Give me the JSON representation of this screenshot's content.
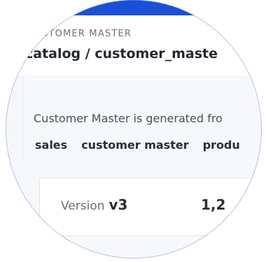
{
  "header": {
    "kicker": "STOMER MASTER",
    "path": "catalog / customer_maste"
  },
  "description": "Customer Master is generated fro",
  "tags": [
    {
      "label": "sales"
    },
    {
      "label": "customer master"
    },
    {
      "label": "produ"
    }
  ],
  "card": {
    "version_label": "Version",
    "version_value": "v3",
    "count": "1,2"
  },
  "colors": {
    "accent_bar": "#1b4fd8",
    "lens_border": "#6b86c9"
  }
}
